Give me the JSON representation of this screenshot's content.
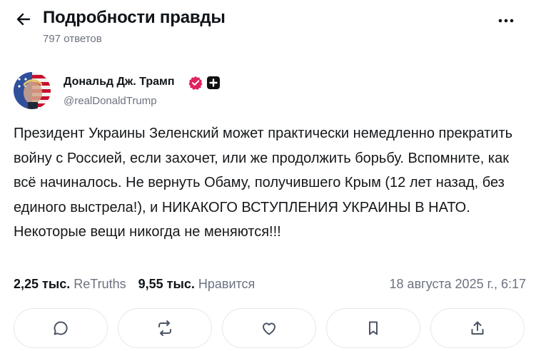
{
  "header": {
    "title": "Подробности правды",
    "replies": "797 ответов"
  },
  "post": {
    "author_name": "Дональд Дж. Трамп",
    "handle": "@realDonaldTrump",
    "text": "Президент Украины Зеленский может практически немедленно прекратить войну с Россией, если захочет, или же продолжить борьбу. Вспомните, как всё начиналось. Не вернуть Обаму, получившего Крым (12 лет назад, без единого выстрела!), и НИКАКОГО ВСТУПЛЕНИЯ УКРАИНЫ В НАТО. Некоторые вещи никогда не меняются!!!",
    "retruths_count": "2,25 тыс.",
    "retruths_label": "ReTruths",
    "likes_count": "9,55 тыс.",
    "likes_label": "Нравится",
    "timestamp": "18 августа 2025 г., 6:17"
  },
  "icons": {
    "back": "arrow-left-icon",
    "more": "more-horizontal-icon",
    "verified": "verified-badge-icon",
    "plus": "plus-badge-icon",
    "reply": "reply-icon",
    "retruth": "retruth-icon",
    "like": "heart-icon",
    "bookmark": "bookmark-icon",
    "share": "share-icon"
  },
  "colors": {
    "text": "#0f1419",
    "muted": "#6b7280",
    "verified": "#e0245e",
    "border": "#e5e7eb"
  }
}
